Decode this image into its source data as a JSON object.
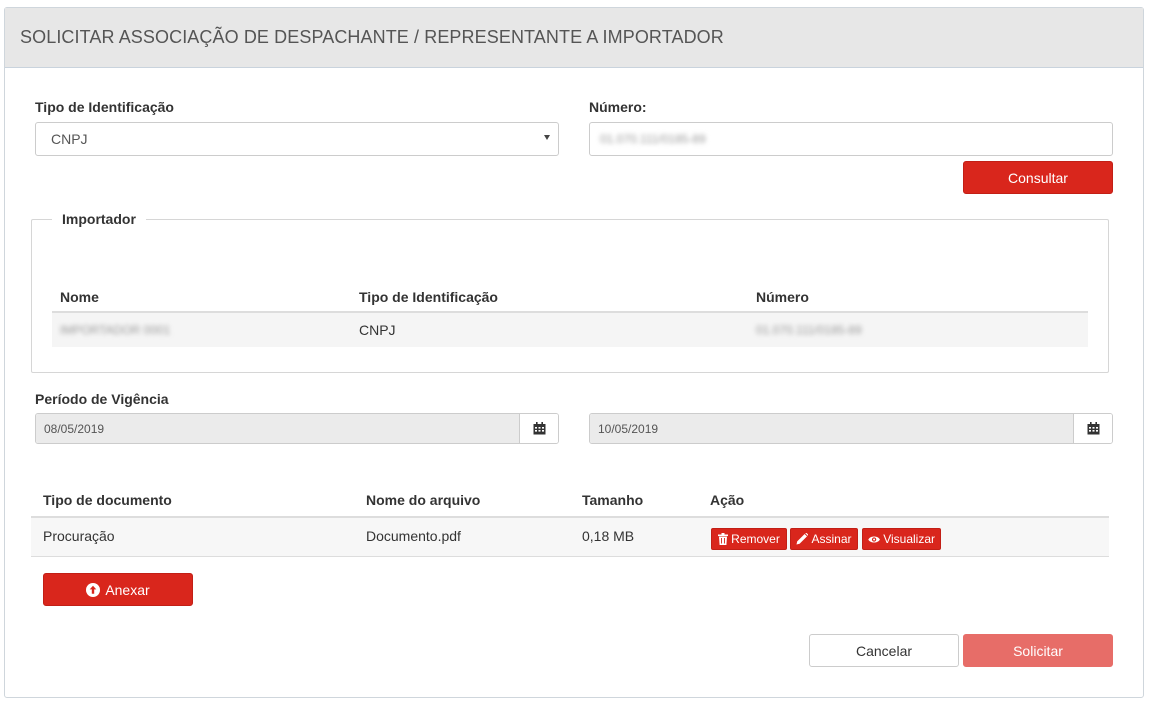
{
  "header": {
    "title": "SOLICITAR ASSOCIAÇÃO DE DESPACHANTE / REPRESENTANTE A IMPORTADOR"
  },
  "form": {
    "tipo_label": "Tipo de Identificação",
    "tipo_value": "CNPJ",
    "numero_label": "Número:",
    "numero_value": "01.070.111/0185-89",
    "consultar_label": "Consultar"
  },
  "importador": {
    "legend": "Importador",
    "columns": [
      "Nome",
      "Tipo de Identificação",
      "Número"
    ],
    "row": {
      "nome": "IMPORTADOR 0001",
      "tipo": "CNPJ",
      "numero": "01.070.111/0185-89"
    }
  },
  "periodo": {
    "label": "Período de Vigência",
    "start": "08/05/2019",
    "end": "10/05/2019"
  },
  "documents": {
    "columns": [
      "Tipo de documento",
      "Nome do arquivo",
      "Tamanho",
      "Ação"
    ],
    "rows": [
      {
        "tipo": "Procuração",
        "arquivo": "Documento.pdf",
        "tamanho": "0,18 MB"
      }
    ],
    "actions": {
      "remover": "Remover",
      "assinar": "Assinar",
      "visualizar": "Visualizar"
    },
    "anexar_label": "Anexar"
  },
  "footer": {
    "cancelar_label": "Cancelar",
    "solicitar_label": "Solicitar"
  },
  "colors": {
    "accent": "#d9261c",
    "accent_disabled": "#e76d68",
    "header_bg": "#e7e7e7"
  },
  "icons": [
    "caret-down-icon",
    "calendar-icon",
    "trash-icon",
    "pencil-icon",
    "eye-icon",
    "upload-circle-icon"
  ]
}
